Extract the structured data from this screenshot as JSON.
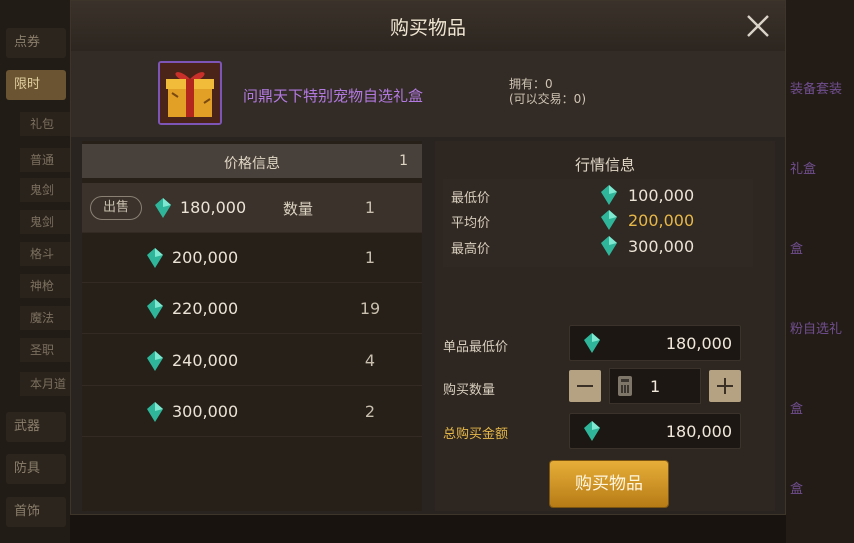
{
  "dialog": {
    "title": "购买物品",
    "item_name": "问鼎天下特别宠物自选礼盒",
    "owned_line": "拥有：0",
    "tradable_line": "(可以交易：0)"
  },
  "price_info": {
    "header": "价格信息",
    "header_count": "1",
    "sell_badge": "出售",
    "qty_label": "数量",
    "rows": [
      {
        "price": "180,000",
        "qty": "1"
      },
      {
        "price": "200,000",
        "qty": "1"
      },
      {
        "price": "220,000",
        "qty": "19"
      },
      {
        "price": "240,000",
        "qty": "4"
      },
      {
        "price": "300,000",
        "qty": "2"
      }
    ]
  },
  "market_info": {
    "title": "行情信息",
    "min_label": "最低价",
    "min_value": "100,000",
    "avg_label": "平均价",
    "avg_value": "200,000",
    "max_label": "最高价",
    "max_value": "300,000"
  },
  "purchase": {
    "unit_price_label": "单品最低价",
    "unit_price_value": "180,000",
    "qty_label": "购买数量",
    "qty_value": "1",
    "total_label": "总购买金额",
    "total_value": "180,000",
    "buy_button": "购买物品"
  },
  "background": {
    "tabs": [
      "点券",
      "限时",
      "武器",
      "防具",
      "首饰"
    ],
    "sub_tabs": [
      "礼包",
      "普通",
      "鬼剑",
      "鬼剑",
      "格斗",
      "神枪",
      "魔法",
      "圣职",
      "本月道"
    ],
    "right_items": [
      "装备套装",
      "礼盒",
      "盒",
      "粉自选礼",
      "盒",
      "盒"
    ]
  },
  "colors": {
    "gem": "#2fb69a",
    "gold_text": "#e6b84a",
    "item_name": "#b27ae0",
    "button": "#d89a2a"
  }
}
